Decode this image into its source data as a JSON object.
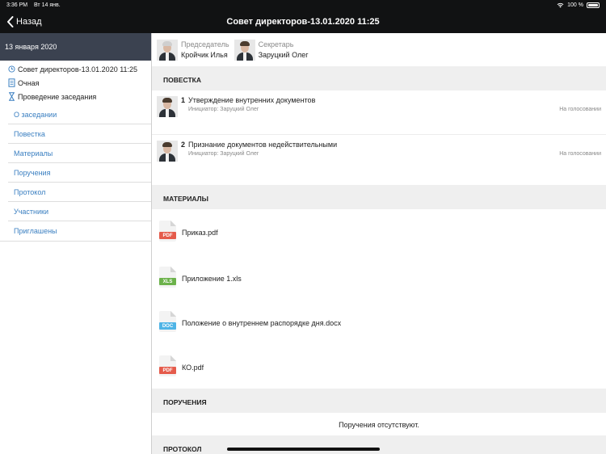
{
  "status_bar": {
    "time": "3:36 PM",
    "date": "Вт 14 янв.",
    "battery": "100 %"
  },
  "nav": {
    "back_label": "Назад",
    "title": "Совет директоров-13.01.2020 11:25"
  },
  "sidebar": {
    "date": "13 января 2020",
    "meta": {
      "meeting": "Совет директоров-13.01.2020 11:25",
      "format": "Очная",
      "stage": "Проведение заседания"
    },
    "menu": [
      "О заседании",
      "Повестка",
      "Материалы",
      "Поручения",
      "Протокол",
      "Участники",
      "Приглашены"
    ]
  },
  "people": [
    {
      "role": "Председатель",
      "name": "Кройчик Илья"
    },
    {
      "role": "Секретарь",
      "name": "Заруцкий Олег"
    }
  ],
  "agenda": {
    "header": "ПОВЕСТКА",
    "items": [
      {
        "num": "1",
        "title": "Утверждение внутренних документов",
        "initiator": "Инициатор: Заруцкий Олег",
        "status": "На голосовании"
      },
      {
        "num": "2",
        "title": "Признание документов недействительными",
        "initiator": "Инициатор: Заруцкий Олег",
        "status": "На голосовании"
      }
    ]
  },
  "materials": {
    "header": "МАТЕРИАЛЫ",
    "items": [
      {
        "type": "PDF",
        "name": "Приказ.pdf",
        "color": "#e55b4b"
      },
      {
        "type": "XLS",
        "name": "Приложение 1.xls",
        "color": "#6cb24b"
      },
      {
        "type": "DOC",
        "name": "Положение о внутреннем распорядке дня.docx",
        "color": "#4fb4e6"
      },
      {
        "type": "PDF",
        "name": "КО.pdf",
        "color": "#e55b4b"
      }
    ]
  },
  "tasks": {
    "header": "ПОРУЧЕНИЯ",
    "empty": "Поручения отсутствуют."
  },
  "protocol": {
    "header": "ПРОТОКОЛ"
  },
  "colors": {
    "accent": "#3a7fc1",
    "topbar": "#111213",
    "sidebar_header": "#3b4250",
    "section_bg": "#efefef"
  }
}
